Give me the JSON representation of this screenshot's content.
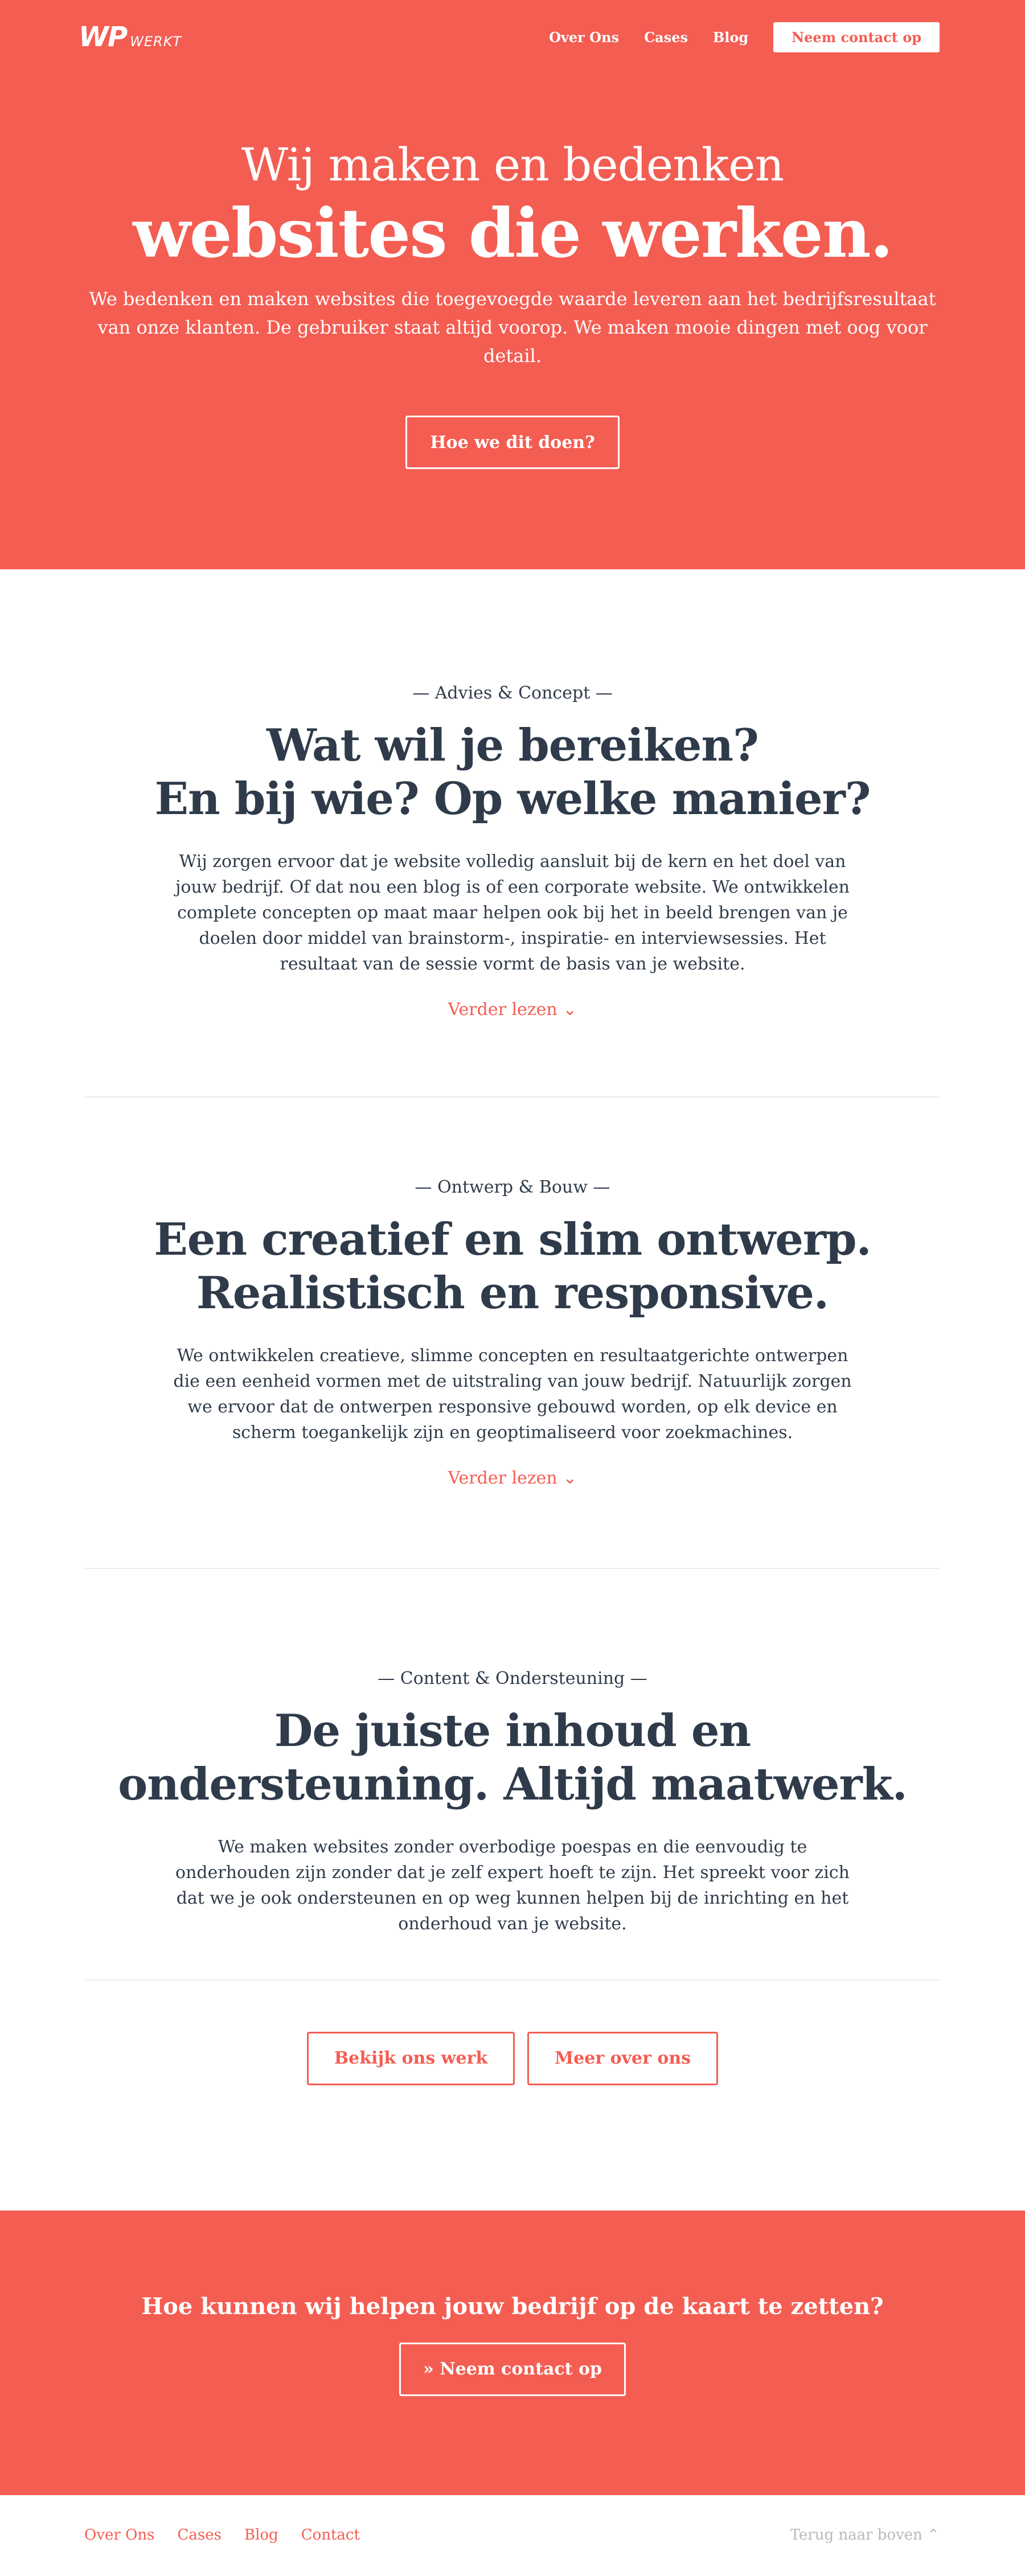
{
  "nav": {
    "logo_main": "WP",
    "logo_sub": "werkt",
    "links": [
      "Over Ons",
      "Cases",
      "Blog"
    ],
    "cta": "Neem contact op"
  },
  "hero": {
    "line1": "Wij maken en bedenken",
    "line2": "websites die werken.",
    "subtitle": "We bedenken en maken websites die toegevoegde waarde leveren aan het bedrijfsresultaat van onze klanten. De gebruiker staat altijd voorop. We maken mooie dingen met oog voor detail.",
    "button": "Hoe we dit doen?"
  },
  "sections": [
    {
      "eyebrow": "— Advies & Concept —",
      "heading_line1": "Wat wil je bereiken?",
      "heading_line2": "En bij wie? Op welke manier?",
      "body": "Wij zorgen ervoor dat je website volledig aansluit bij de kern en het doel van jouw bedrijf. Of dat nou een blog is of een corporate website. We ontwikkelen complete concepten op maat maar helpen ook bij het in beeld brengen van je doelen door middel van brainstorm-, inspiratie- en interviewsessies. Het resultaat van de sessie vormt de basis van je website.",
      "link": "Verder lezen"
    },
    {
      "eyebrow": "— Ontwerp & Bouw —",
      "heading_line1": "Een creatief en slim ontwerp.",
      "heading_line2": "Realistisch en responsive.",
      "body": "We ontwikkelen creatieve, slimme concepten en resultaatgerichte ontwerpen die een eenheid vormen met de uitstraling van jouw bedrijf. Natuurlijk zorgen we ervoor dat de ontwerpen responsive gebouwd worden, op elk device en scherm toegankelijk zijn en geoptimaliseerd voor zoekmachines.",
      "link": "Verder lezen"
    },
    {
      "eyebrow": "— Content & Ondersteuning —",
      "heading_line1": "De juiste inhoud en",
      "heading_line2": "ondersteuning. Altijd maatwerk.",
      "body": "We maken websites zonder overbodige poespas en die eenvoudig te onderhouden zijn zonder dat je zelf expert hoeft te zijn. Het spreekt voor zich dat we je ook ondersteunen en op weg kunnen helpen bij de inrichting en het onderhoud van je website."
    }
  ],
  "buttons": {
    "work": "Bekijk ons werk",
    "about": "Meer over ons"
  },
  "cta": {
    "title": "Hoe kunnen wij helpen jouw bedrijf op de kaart te zetten?",
    "button": "Neem contact op"
  },
  "footer": {
    "links": [
      "Over Ons",
      "Cases",
      "Blog",
      "Contact"
    ],
    "back_to_top": "Terug naar boven"
  },
  "colors": {
    "brand": "#f45d52",
    "text": "#2f3b4a",
    "muted": "#b6b9bd"
  }
}
